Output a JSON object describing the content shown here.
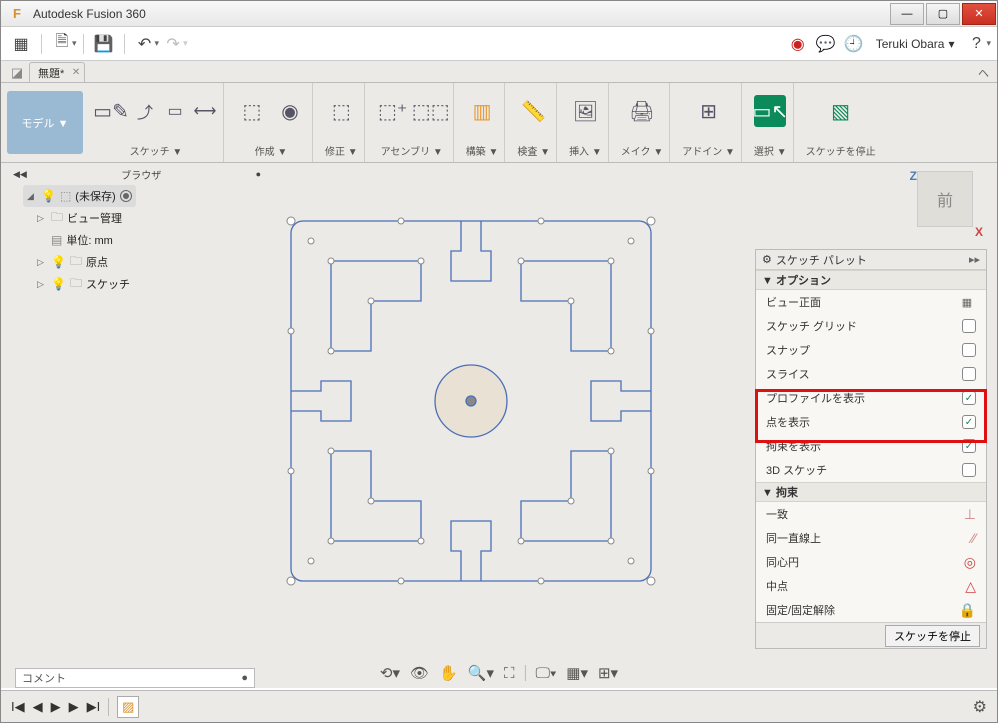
{
  "app": {
    "title": "Autodesk Fusion 360",
    "logo_letter": "F"
  },
  "user": {
    "name": "Teruki Obara"
  },
  "tab": {
    "name": "無題*"
  },
  "ribbon": {
    "mode": "モデル ▼",
    "groups": {
      "sketch": "スケッチ ▼",
      "create": "作成 ▼",
      "modify": "修正 ▼",
      "assembly": "アセンブリ ▼",
      "construct": "構築 ▼",
      "inspect": "検査 ▼",
      "insert": "挿入 ▼",
      "make": "メイク ▼",
      "addins": "アドイン ▼",
      "select": "選択 ▼",
      "stop_sketch": "スケッチを停止"
    }
  },
  "browser": {
    "title": "ブラウザ",
    "root": "(未保存)",
    "items": {
      "views": "ビュー管理",
      "units": "単位: mm",
      "origin": "原点",
      "sketches": "スケッチ"
    }
  },
  "viewcube": {
    "face": "前",
    "axis_z": "Z",
    "axis_x": "X"
  },
  "palette": {
    "title": "スケッチ パレット",
    "sec_options": "▼ オプション",
    "sec_constraints": "▼ 拘束",
    "options": {
      "look_at": "ビュー正面",
      "grid": "スケッチ グリッド",
      "snap": "スナップ",
      "slice": "スライス",
      "show_profile": "プロファイルを表示",
      "show_points": "点を表示",
      "show_constraints": "拘束を表示",
      "sketch_3d": "3D スケッチ"
    },
    "constraints": {
      "coincident": "一致",
      "collinear": "同一直線上",
      "concentric": "同心円",
      "midpoint": "中点",
      "fix": "固定/固定解除"
    },
    "stop_button": "スケッチを停止"
  },
  "comment_label": "コメント"
}
